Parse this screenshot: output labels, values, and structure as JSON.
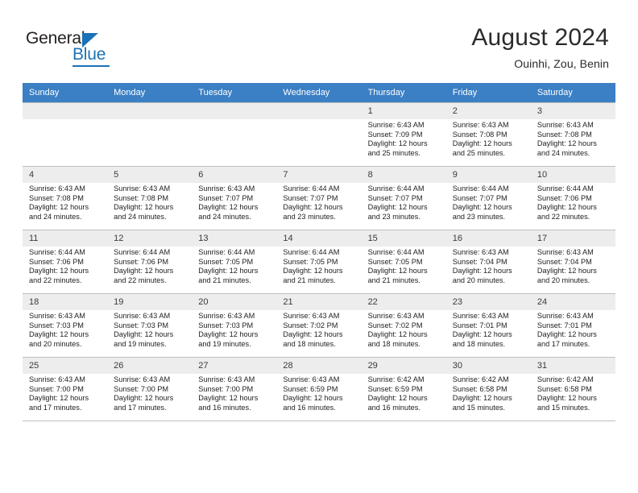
{
  "brand": {
    "name_part1": "General",
    "name_part2": "Blue"
  },
  "header": {
    "title": "August 2024",
    "subtitle": "Ouinhi, Zou, Benin"
  },
  "weekdays": [
    "Sunday",
    "Monday",
    "Tuesday",
    "Wednesday",
    "Thursday",
    "Friday",
    "Saturday"
  ],
  "colors": {
    "header_band": "#3b7fc4",
    "brand_blue": "#1b72b8",
    "cell_shade": "#ededed",
    "grid_line": "#bfbfbf"
  },
  "weeks": [
    [
      {
        "day": "",
        "sunrise": "",
        "sunset": "",
        "daylight1": "",
        "daylight2": ""
      },
      {
        "day": "",
        "sunrise": "",
        "sunset": "",
        "daylight1": "",
        "daylight2": ""
      },
      {
        "day": "",
        "sunrise": "",
        "sunset": "",
        "daylight1": "",
        "daylight2": ""
      },
      {
        "day": "",
        "sunrise": "",
        "sunset": "",
        "daylight1": "",
        "daylight2": ""
      },
      {
        "day": "1",
        "sunrise": "Sunrise: 6:43 AM",
        "sunset": "Sunset: 7:09 PM",
        "daylight1": "Daylight: 12 hours",
        "daylight2": "and 25 minutes."
      },
      {
        "day": "2",
        "sunrise": "Sunrise: 6:43 AM",
        "sunset": "Sunset: 7:08 PM",
        "daylight1": "Daylight: 12 hours",
        "daylight2": "and 25 minutes."
      },
      {
        "day": "3",
        "sunrise": "Sunrise: 6:43 AM",
        "sunset": "Sunset: 7:08 PM",
        "daylight1": "Daylight: 12 hours",
        "daylight2": "and 24 minutes."
      }
    ],
    [
      {
        "day": "4",
        "sunrise": "Sunrise: 6:43 AM",
        "sunset": "Sunset: 7:08 PM",
        "daylight1": "Daylight: 12 hours",
        "daylight2": "and 24 minutes."
      },
      {
        "day": "5",
        "sunrise": "Sunrise: 6:43 AM",
        "sunset": "Sunset: 7:08 PM",
        "daylight1": "Daylight: 12 hours",
        "daylight2": "and 24 minutes."
      },
      {
        "day": "6",
        "sunrise": "Sunrise: 6:43 AM",
        "sunset": "Sunset: 7:07 PM",
        "daylight1": "Daylight: 12 hours",
        "daylight2": "and 24 minutes."
      },
      {
        "day": "7",
        "sunrise": "Sunrise: 6:44 AM",
        "sunset": "Sunset: 7:07 PM",
        "daylight1": "Daylight: 12 hours",
        "daylight2": "and 23 minutes."
      },
      {
        "day": "8",
        "sunrise": "Sunrise: 6:44 AM",
        "sunset": "Sunset: 7:07 PM",
        "daylight1": "Daylight: 12 hours",
        "daylight2": "and 23 minutes."
      },
      {
        "day": "9",
        "sunrise": "Sunrise: 6:44 AM",
        "sunset": "Sunset: 7:07 PM",
        "daylight1": "Daylight: 12 hours",
        "daylight2": "and 23 minutes."
      },
      {
        "day": "10",
        "sunrise": "Sunrise: 6:44 AM",
        "sunset": "Sunset: 7:06 PM",
        "daylight1": "Daylight: 12 hours",
        "daylight2": "and 22 minutes."
      }
    ],
    [
      {
        "day": "11",
        "sunrise": "Sunrise: 6:44 AM",
        "sunset": "Sunset: 7:06 PM",
        "daylight1": "Daylight: 12 hours",
        "daylight2": "and 22 minutes."
      },
      {
        "day": "12",
        "sunrise": "Sunrise: 6:44 AM",
        "sunset": "Sunset: 7:06 PM",
        "daylight1": "Daylight: 12 hours",
        "daylight2": "and 22 minutes."
      },
      {
        "day": "13",
        "sunrise": "Sunrise: 6:44 AM",
        "sunset": "Sunset: 7:05 PM",
        "daylight1": "Daylight: 12 hours",
        "daylight2": "and 21 minutes."
      },
      {
        "day": "14",
        "sunrise": "Sunrise: 6:44 AM",
        "sunset": "Sunset: 7:05 PM",
        "daylight1": "Daylight: 12 hours",
        "daylight2": "and 21 minutes."
      },
      {
        "day": "15",
        "sunrise": "Sunrise: 6:44 AM",
        "sunset": "Sunset: 7:05 PM",
        "daylight1": "Daylight: 12 hours",
        "daylight2": "and 21 minutes."
      },
      {
        "day": "16",
        "sunrise": "Sunrise: 6:43 AM",
        "sunset": "Sunset: 7:04 PM",
        "daylight1": "Daylight: 12 hours",
        "daylight2": "and 20 minutes."
      },
      {
        "day": "17",
        "sunrise": "Sunrise: 6:43 AM",
        "sunset": "Sunset: 7:04 PM",
        "daylight1": "Daylight: 12 hours",
        "daylight2": "and 20 minutes."
      }
    ],
    [
      {
        "day": "18",
        "sunrise": "Sunrise: 6:43 AM",
        "sunset": "Sunset: 7:03 PM",
        "daylight1": "Daylight: 12 hours",
        "daylight2": "and 20 minutes."
      },
      {
        "day": "19",
        "sunrise": "Sunrise: 6:43 AM",
        "sunset": "Sunset: 7:03 PM",
        "daylight1": "Daylight: 12 hours",
        "daylight2": "and 19 minutes."
      },
      {
        "day": "20",
        "sunrise": "Sunrise: 6:43 AM",
        "sunset": "Sunset: 7:03 PM",
        "daylight1": "Daylight: 12 hours",
        "daylight2": "and 19 minutes."
      },
      {
        "day": "21",
        "sunrise": "Sunrise: 6:43 AM",
        "sunset": "Sunset: 7:02 PM",
        "daylight1": "Daylight: 12 hours",
        "daylight2": "and 18 minutes."
      },
      {
        "day": "22",
        "sunrise": "Sunrise: 6:43 AM",
        "sunset": "Sunset: 7:02 PM",
        "daylight1": "Daylight: 12 hours",
        "daylight2": "and 18 minutes."
      },
      {
        "day": "23",
        "sunrise": "Sunrise: 6:43 AM",
        "sunset": "Sunset: 7:01 PM",
        "daylight1": "Daylight: 12 hours",
        "daylight2": "and 18 minutes."
      },
      {
        "day": "24",
        "sunrise": "Sunrise: 6:43 AM",
        "sunset": "Sunset: 7:01 PM",
        "daylight1": "Daylight: 12 hours",
        "daylight2": "and 17 minutes."
      }
    ],
    [
      {
        "day": "25",
        "sunrise": "Sunrise: 6:43 AM",
        "sunset": "Sunset: 7:00 PM",
        "daylight1": "Daylight: 12 hours",
        "daylight2": "and 17 minutes."
      },
      {
        "day": "26",
        "sunrise": "Sunrise: 6:43 AM",
        "sunset": "Sunset: 7:00 PM",
        "daylight1": "Daylight: 12 hours",
        "daylight2": "and 17 minutes."
      },
      {
        "day": "27",
        "sunrise": "Sunrise: 6:43 AM",
        "sunset": "Sunset: 7:00 PM",
        "daylight1": "Daylight: 12 hours",
        "daylight2": "and 16 minutes."
      },
      {
        "day": "28",
        "sunrise": "Sunrise: 6:43 AM",
        "sunset": "Sunset: 6:59 PM",
        "daylight1": "Daylight: 12 hours",
        "daylight2": "and 16 minutes."
      },
      {
        "day": "29",
        "sunrise": "Sunrise: 6:42 AM",
        "sunset": "Sunset: 6:59 PM",
        "daylight1": "Daylight: 12 hours",
        "daylight2": "and 16 minutes."
      },
      {
        "day": "30",
        "sunrise": "Sunrise: 6:42 AM",
        "sunset": "Sunset: 6:58 PM",
        "daylight1": "Daylight: 12 hours",
        "daylight2": "and 15 minutes."
      },
      {
        "day": "31",
        "sunrise": "Sunrise: 6:42 AM",
        "sunset": "Sunset: 6:58 PM",
        "daylight1": "Daylight: 12 hours",
        "daylight2": "and 15 minutes."
      }
    ]
  ]
}
